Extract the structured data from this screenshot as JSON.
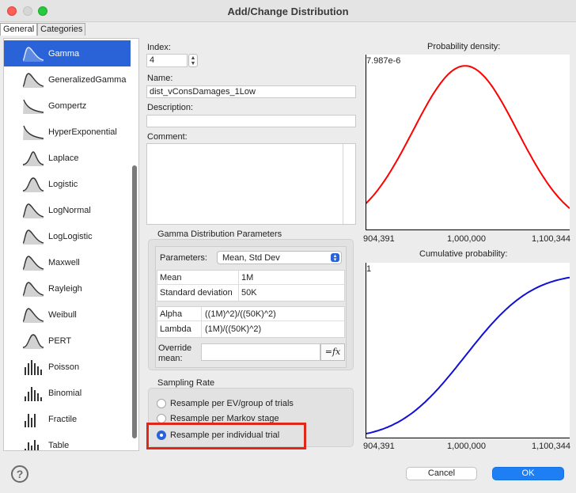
{
  "window": {
    "title": "Add/Change Distribution"
  },
  "tabs": [
    {
      "label": "General",
      "active": true
    },
    {
      "label": "Categories",
      "active": false
    }
  ],
  "distributions": [
    {
      "label": "Gamma",
      "icon": "gamma-curve-icon",
      "selected": true
    },
    {
      "label": "GeneralizedGamma",
      "icon": "generalized-gamma-curve-icon",
      "selected": false
    },
    {
      "label": "Gompertz",
      "icon": "gompertz-curve-icon",
      "selected": false
    },
    {
      "label": "HyperExponential",
      "icon": "hyperexponential-curve-icon",
      "selected": false
    },
    {
      "label": "Laplace",
      "icon": "laplace-curve-icon",
      "selected": false
    },
    {
      "label": "Logistic",
      "icon": "logistic-curve-icon",
      "selected": false
    },
    {
      "label": "LogNormal",
      "icon": "lognormal-curve-icon",
      "selected": false
    },
    {
      "label": "LogLogistic",
      "icon": "loglogistic-curve-icon",
      "selected": false
    },
    {
      "label": "Maxwell",
      "icon": "maxwell-curve-icon",
      "selected": false
    },
    {
      "label": "Rayleigh",
      "icon": "rayleigh-curve-icon",
      "selected": false
    },
    {
      "label": "Weibull",
      "icon": "weibull-curve-icon",
      "selected": false
    },
    {
      "label": "PERT",
      "icon": "pert-curve-icon",
      "selected": false
    },
    {
      "label": "Poisson",
      "icon": "poisson-bars-icon",
      "selected": false
    },
    {
      "label": "Binomial",
      "icon": "binomial-bars-icon",
      "selected": false
    },
    {
      "label": "Fractile",
      "icon": "fractile-bars-icon",
      "selected": false
    },
    {
      "label": "Table",
      "icon": "table-bars-icon",
      "selected": false
    }
  ],
  "form": {
    "index_label": "Index:",
    "index_value": "4",
    "name_label": "Name:",
    "name_value": "dist_vConsDamages_1Low",
    "description_label": "Description:",
    "description_value": "",
    "comment_label": "Comment:",
    "comment_value": ""
  },
  "params": {
    "group_label": "Gamma Distribution Parameters",
    "parameters_label": "Parameters:",
    "parameters_selected": "Mean, Std Dev",
    "inputs": [
      {
        "name": "Mean",
        "value": "1M"
      },
      {
        "name": "Standard deviation",
        "value": "50K"
      }
    ],
    "derived": [
      {
        "name": "Alpha",
        "value": "((1M)^2)/((50K)^2)"
      },
      {
        "name": "Lambda",
        "value": "(1M)/((50K)^2)"
      }
    ],
    "override_label_1": "Override",
    "override_label_2": "mean:",
    "override_value": "",
    "fx_label": "=fx"
  },
  "sampling": {
    "group_label": "Sampling Rate",
    "options": [
      {
        "label": "Resample per EV/group of trials",
        "selected": false
      },
      {
        "label": "Resample per Markov stage",
        "selected": false
      },
      {
        "label": "Resample per individual trial",
        "selected": true
      }
    ]
  },
  "density_chart": {
    "title": "Probability density:",
    "y_max_label": "7.987e-6",
    "x_ticks": [
      "904,391",
      "1,000,000",
      "1,100,344"
    ],
    "color": "#ff0000"
  },
  "cumulative_chart": {
    "title": "Cumulative probability:",
    "y_max_label": "1",
    "x_ticks": [
      "904,391",
      "1,000,000",
      "1,100,344"
    ],
    "color": "#1010d8"
  },
  "chart_data": [
    {
      "type": "line",
      "title": "Probability density:",
      "x_range": [
        904391,
        1100344
      ],
      "y_max": 7.987e-06,
      "x_ticks": [
        "904,391",
        "1,000,000",
        "1,100,344"
      ],
      "distribution": {
        "name": "Gamma",
        "mean": 1000000,
        "std_dev": 50000
      }
    },
    {
      "type": "line",
      "title": "Cumulative probability:",
      "x_range": [
        904391,
        1100344
      ],
      "y_max": 1,
      "x_ticks": [
        "904,391",
        "1,000,000",
        "1,100,344"
      ],
      "distribution": {
        "name": "Gamma",
        "mean": 1000000,
        "std_dev": 50000
      }
    }
  ],
  "buttons": {
    "help": "?",
    "cancel": "Cancel",
    "ok": "OK"
  }
}
